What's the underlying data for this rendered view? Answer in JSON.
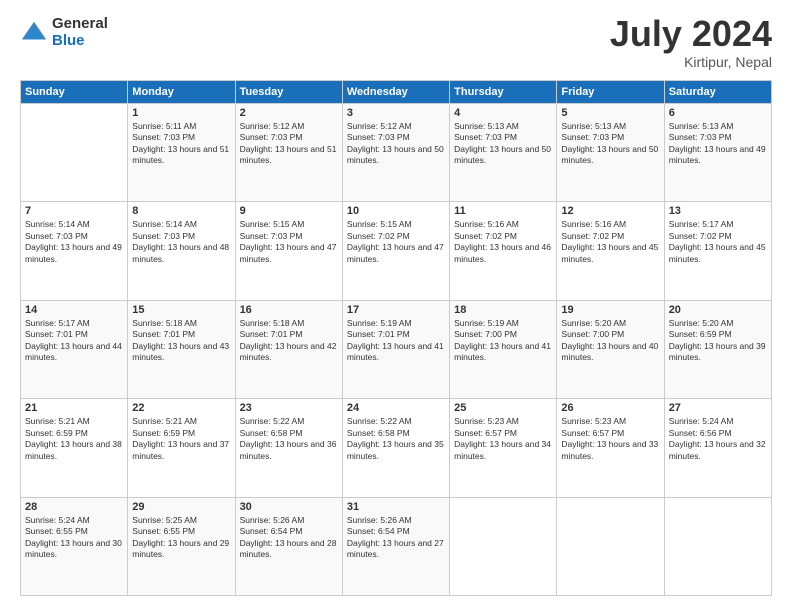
{
  "logo": {
    "general": "General",
    "blue": "Blue"
  },
  "title": {
    "month_year": "July 2024",
    "location": "Kirtipur, Nepal"
  },
  "days_header": [
    "Sunday",
    "Monday",
    "Tuesday",
    "Wednesday",
    "Thursday",
    "Friday",
    "Saturday"
  ],
  "weeks": [
    [
      {
        "day": "",
        "sunrise": "",
        "sunset": "",
        "daylight": ""
      },
      {
        "day": "1",
        "sunrise": "Sunrise: 5:11 AM",
        "sunset": "Sunset: 7:03 PM",
        "daylight": "Daylight: 13 hours and 51 minutes."
      },
      {
        "day": "2",
        "sunrise": "Sunrise: 5:12 AM",
        "sunset": "Sunset: 7:03 PM",
        "daylight": "Daylight: 13 hours and 51 minutes."
      },
      {
        "day": "3",
        "sunrise": "Sunrise: 5:12 AM",
        "sunset": "Sunset: 7:03 PM",
        "daylight": "Daylight: 13 hours and 50 minutes."
      },
      {
        "day": "4",
        "sunrise": "Sunrise: 5:13 AM",
        "sunset": "Sunset: 7:03 PM",
        "daylight": "Daylight: 13 hours and 50 minutes."
      },
      {
        "day": "5",
        "sunrise": "Sunrise: 5:13 AM",
        "sunset": "Sunset: 7:03 PM",
        "daylight": "Daylight: 13 hours and 50 minutes."
      },
      {
        "day": "6",
        "sunrise": "Sunrise: 5:13 AM",
        "sunset": "Sunset: 7:03 PM",
        "daylight": "Daylight: 13 hours and 49 minutes."
      }
    ],
    [
      {
        "day": "7",
        "sunrise": "Sunrise: 5:14 AM",
        "sunset": "Sunset: 7:03 PM",
        "daylight": "Daylight: 13 hours and 49 minutes."
      },
      {
        "day": "8",
        "sunrise": "Sunrise: 5:14 AM",
        "sunset": "Sunset: 7:03 PM",
        "daylight": "Daylight: 13 hours and 48 minutes."
      },
      {
        "day": "9",
        "sunrise": "Sunrise: 5:15 AM",
        "sunset": "Sunset: 7:03 PM",
        "daylight": "Daylight: 13 hours and 47 minutes."
      },
      {
        "day": "10",
        "sunrise": "Sunrise: 5:15 AM",
        "sunset": "Sunset: 7:02 PM",
        "daylight": "Daylight: 13 hours and 47 minutes."
      },
      {
        "day": "11",
        "sunrise": "Sunrise: 5:16 AM",
        "sunset": "Sunset: 7:02 PM",
        "daylight": "Daylight: 13 hours and 46 minutes."
      },
      {
        "day": "12",
        "sunrise": "Sunrise: 5:16 AM",
        "sunset": "Sunset: 7:02 PM",
        "daylight": "Daylight: 13 hours and 45 minutes."
      },
      {
        "day": "13",
        "sunrise": "Sunrise: 5:17 AM",
        "sunset": "Sunset: 7:02 PM",
        "daylight": "Daylight: 13 hours and 45 minutes."
      }
    ],
    [
      {
        "day": "14",
        "sunrise": "Sunrise: 5:17 AM",
        "sunset": "Sunset: 7:01 PM",
        "daylight": "Daylight: 13 hours and 44 minutes."
      },
      {
        "day": "15",
        "sunrise": "Sunrise: 5:18 AM",
        "sunset": "Sunset: 7:01 PM",
        "daylight": "Daylight: 13 hours and 43 minutes."
      },
      {
        "day": "16",
        "sunrise": "Sunrise: 5:18 AM",
        "sunset": "Sunset: 7:01 PM",
        "daylight": "Daylight: 13 hours and 42 minutes."
      },
      {
        "day": "17",
        "sunrise": "Sunrise: 5:19 AM",
        "sunset": "Sunset: 7:01 PM",
        "daylight": "Daylight: 13 hours and 41 minutes."
      },
      {
        "day": "18",
        "sunrise": "Sunrise: 5:19 AM",
        "sunset": "Sunset: 7:00 PM",
        "daylight": "Daylight: 13 hours and 41 minutes."
      },
      {
        "day": "19",
        "sunrise": "Sunrise: 5:20 AM",
        "sunset": "Sunset: 7:00 PM",
        "daylight": "Daylight: 13 hours and 40 minutes."
      },
      {
        "day": "20",
        "sunrise": "Sunrise: 5:20 AM",
        "sunset": "Sunset: 6:59 PM",
        "daylight": "Daylight: 13 hours and 39 minutes."
      }
    ],
    [
      {
        "day": "21",
        "sunrise": "Sunrise: 5:21 AM",
        "sunset": "Sunset: 6:59 PM",
        "daylight": "Daylight: 13 hours and 38 minutes."
      },
      {
        "day": "22",
        "sunrise": "Sunrise: 5:21 AM",
        "sunset": "Sunset: 6:59 PM",
        "daylight": "Daylight: 13 hours and 37 minutes."
      },
      {
        "day": "23",
        "sunrise": "Sunrise: 5:22 AM",
        "sunset": "Sunset: 6:58 PM",
        "daylight": "Daylight: 13 hours and 36 minutes."
      },
      {
        "day": "24",
        "sunrise": "Sunrise: 5:22 AM",
        "sunset": "Sunset: 6:58 PM",
        "daylight": "Daylight: 13 hours and 35 minutes."
      },
      {
        "day": "25",
        "sunrise": "Sunrise: 5:23 AM",
        "sunset": "Sunset: 6:57 PM",
        "daylight": "Daylight: 13 hours and 34 minutes."
      },
      {
        "day": "26",
        "sunrise": "Sunrise: 5:23 AM",
        "sunset": "Sunset: 6:57 PM",
        "daylight": "Daylight: 13 hours and 33 minutes."
      },
      {
        "day": "27",
        "sunrise": "Sunrise: 5:24 AM",
        "sunset": "Sunset: 6:56 PM",
        "daylight": "Daylight: 13 hours and 32 minutes."
      }
    ],
    [
      {
        "day": "28",
        "sunrise": "Sunrise: 5:24 AM",
        "sunset": "Sunset: 6:55 PM",
        "daylight": "Daylight: 13 hours and 30 minutes."
      },
      {
        "day": "29",
        "sunrise": "Sunrise: 5:25 AM",
        "sunset": "Sunset: 6:55 PM",
        "daylight": "Daylight: 13 hours and 29 minutes."
      },
      {
        "day": "30",
        "sunrise": "Sunrise: 5:26 AM",
        "sunset": "Sunset: 6:54 PM",
        "daylight": "Daylight: 13 hours and 28 minutes."
      },
      {
        "day": "31",
        "sunrise": "Sunrise: 5:26 AM",
        "sunset": "Sunset: 6:54 PM",
        "daylight": "Daylight: 13 hours and 27 minutes."
      },
      {
        "day": "",
        "sunrise": "",
        "sunset": "",
        "daylight": ""
      },
      {
        "day": "",
        "sunrise": "",
        "sunset": "",
        "daylight": ""
      },
      {
        "day": "",
        "sunrise": "",
        "sunset": "",
        "daylight": ""
      }
    ]
  ]
}
